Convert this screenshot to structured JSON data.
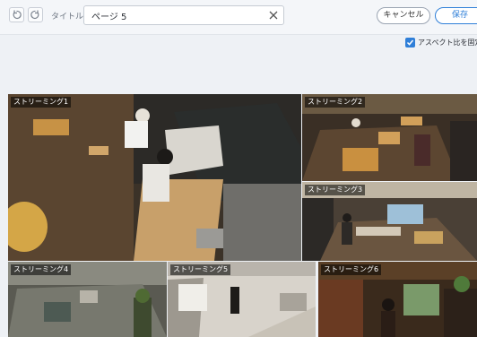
{
  "toolbar": {
    "undo_icon": "undo-icon",
    "redo_icon": "redo-icon",
    "title_label": "タイトル",
    "title_value": "ページ 5",
    "clear_icon": "close-icon",
    "cancel_label": "キャンセル",
    "save_label": "保存"
  },
  "options": {
    "aspect_label": "アスペクト比を固定",
    "aspect_checked": true
  },
  "streams": [
    {
      "label": "ストリーミング1"
    },
    {
      "label": "ストリーミング2"
    },
    {
      "label": "ストリーミング3"
    },
    {
      "label": "ストリーミング4"
    },
    {
      "label": "ストリーミング5"
    },
    {
      "label": "ストリーミング6"
    }
  ],
  "colors": {
    "accent": "#2f7fd8",
    "background": "#eef1f5"
  }
}
